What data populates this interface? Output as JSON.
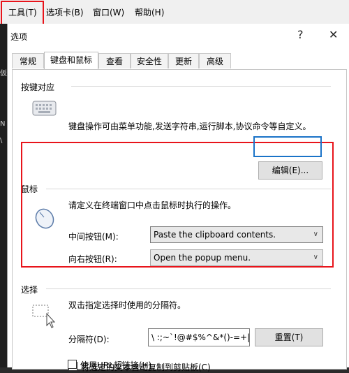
{
  "menubar": {
    "items": [
      {
        "label": "工具(T)"
      },
      {
        "label": "选项卡(B)"
      },
      {
        "label": "窗口(W)"
      },
      {
        "label": "帮助(H)"
      }
    ]
  },
  "left_strip": {
    "labels": [
      "仮",
      "N",
      "\\"
    ]
  },
  "dialog": {
    "title": "选项",
    "help_glyph": "?",
    "close_glyph": "✕",
    "tabs": [
      {
        "label": "常规"
      },
      {
        "label": "键盘和鼠标"
      },
      {
        "label": "查看"
      },
      {
        "label": "安全性"
      },
      {
        "label": "更新"
      },
      {
        "label": "高级"
      }
    ],
    "active_tab": "键盘和鼠标"
  },
  "keyboard_section": {
    "title": "按键对应",
    "description": "键盘操作可由菜单功能,发送字符串,运行脚本,协议命令等自定义。",
    "edit_button": "编辑(E)..."
  },
  "mouse_section": {
    "title": "鼠标",
    "description": "请定义在终端窗口中点击鼠标时执行的操作。",
    "middle_button_label": "中间按钮(M):",
    "middle_button_value": "Paste the clipboard contents.",
    "right_button_label": "向右按钮(R):",
    "right_button_value": "Open the popup menu."
  },
  "selection_section": {
    "title": "选择",
    "description": "双击指定选择时使用的分隔符。",
    "delimiter_label": "分隔符(D):",
    "delimiter_value": "\\ :;~`!@#$%^&*()-=+|[]{}'\",.<>/?",
    "reset_button": "重置(T)",
    "auto_copy_label": "将选定的文本自动复制到剪贴板(C)",
    "url_link_label": "使用URL超链接(H)"
  },
  "colors": {
    "highlight_red": "#e8141b",
    "highlight_blue": "#1a73c8"
  }
}
